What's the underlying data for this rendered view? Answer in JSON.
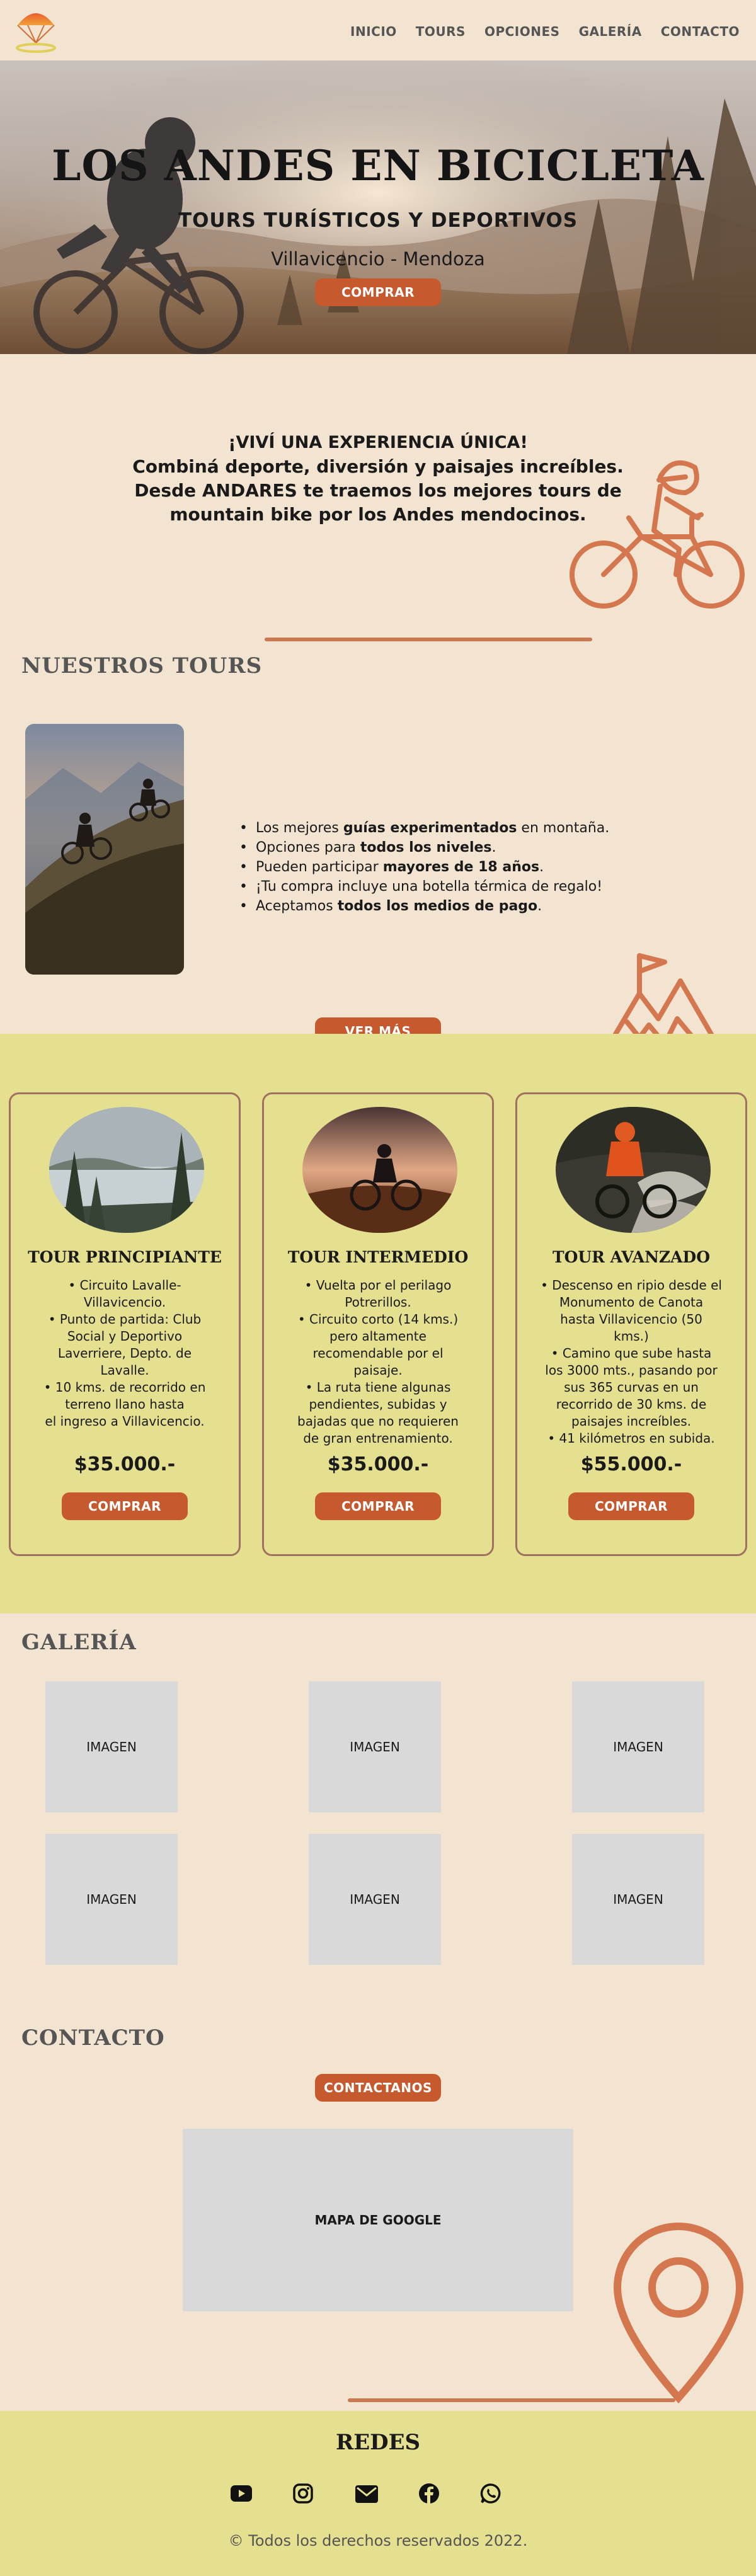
{
  "nav": {
    "items": [
      "INICIO",
      "TOURS",
      "OPCIONES",
      "GALERÍA",
      "CONTACTO"
    ]
  },
  "hero": {
    "title": "LOS ANDES EN BICICLETA",
    "subtitle": "TOURS TURÍSTICOS Y DEPORTIVOS",
    "location": "Villavicencio - Mendoza",
    "button": "COMPRAR"
  },
  "intro": {
    "line1": "¡VIVÍ UNA EXPERIENCIA ÚNICA!",
    "line2": "Combiná deporte, diversión y paisajes increíbles.",
    "line3": "Desde ANDARES te traemos los mejores tours de",
    "line4": "mountain bike por los Andes mendocinos."
  },
  "tours": {
    "title": "NUESTROS TOURS",
    "features": [
      {
        "pre": "Los mejores ",
        "bold": "guías experimentados",
        "post": " en montaña."
      },
      {
        "pre": "Opciones para ",
        "bold": "todos los niveles",
        "post": "."
      },
      {
        "pre": "Pueden participar ",
        "bold": "mayores de 18 años",
        "post": "."
      },
      {
        "pre": "¡Tu compra incluye una botella térmica de regalo!",
        "bold": "",
        "post": ""
      },
      {
        "pre": "Aceptamos ",
        "bold": "todos los medios de pago",
        "post": "."
      }
    ],
    "button": "VER MÁS"
  },
  "cards": [
    {
      "title": "TOUR PRINCIPIANTE",
      "lines": [
        "•  Circuito Lavalle-",
        "Villavicencio.",
        "•  Punto de partida: Club",
        "Social y Deportivo",
        "Laverriere, Depto. de",
        "Lavalle.",
        "•  10 kms. de recorrido en",
        "terreno llano hasta",
        "el ingreso a Villavicencio."
      ],
      "price": "$35.000.-",
      "button": "COMPRAR"
    },
    {
      "title": "TOUR INTERMEDIO",
      "lines": [
        "•  Vuelta por el perilago",
        "Potrerillos.",
        "•  Circuito corto (14 kms.)",
        "pero altamente",
        "recomendable por el",
        "paisaje.",
        "•  La ruta tiene algunas",
        "pendientes, subidas y",
        "bajadas que no requieren",
        "de gran entrenamiento."
      ],
      "price": "$35.000.-",
      "button": "COMPRAR"
    },
    {
      "title": "TOUR AVANZADO",
      "lines": [
        "•  Descenso en ripio desde el",
        "Monumento de Canota",
        "hasta Villavicencio (50",
        "kms.)",
        "•  Camino que sube  hasta",
        "los 3000 mts., pasando por",
        "sus 365 curvas en un",
        "recorrido de 30 kms. de",
        "paisajes increíbles.",
        "•  41 kilómetros en subida."
      ],
      "price": "$55.000.-",
      "button": "COMPRAR"
    }
  ],
  "gallery": {
    "title": "GALERÍA",
    "items": [
      "IMAGEN",
      "IMAGEN",
      "IMAGEN",
      "IMAGEN",
      "IMAGEN",
      "IMAGEN"
    ]
  },
  "contact": {
    "title": "CONTACTO",
    "button": "CONTACTANOS",
    "map": "MAPA DE GOOGLE"
  },
  "footer": {
    "title": "REDES",
    "icons": [
      "youtube-icon",
      "instagram-icon",
      "email-icon",
      "facebook-icon",
      "whatsapp-icon"
    ],
    "copyright": "© Todos los derechos reservados 2022."
  },
  "colors": {
    "background": "#f2e4d0",
    "accent": "#c65a2e",
    "line": "#c97850",
    "band": "#e5e090",
    "card_border": "#a07060",
    "placeholder": "#d9d9d9"
  }
}
